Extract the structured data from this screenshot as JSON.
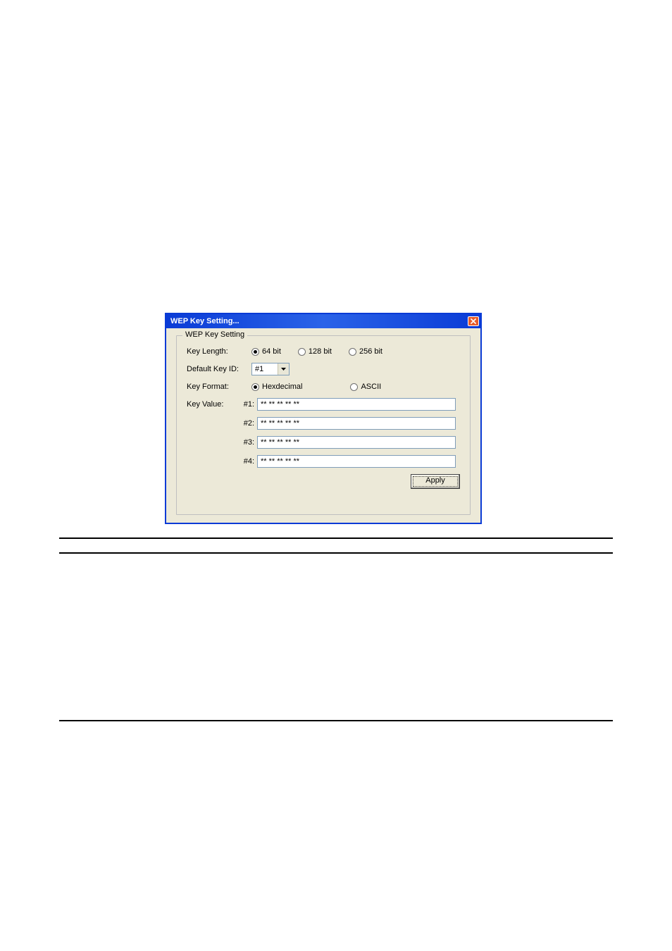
{
  "dialog": {
    "title": "WEP Key Setting...",
    "groupTitle": "WEP Key Setting",
    "labels": {
      "keyLength": "Key Length:",
      "defaultKeyId": "Default Key ID:",
      "keyFormat": "Key Format:",
      "keyValue": "Key Value:"
    },
    "keyLengthOptions": {
      "opt64": "64 bit",
      "opt128": "128 bit",
      "opt256": "256 bit"
    },
    "defaultKeyIdValue": "#1",
    "keyFormatOptions": {
      "hex": "Hexdecimal",
      "ascii": "ASCII"
    },
    "keyIdx": {
      "k1": "#1:",
      "k2": "#2:",
      "k3": "#3:",
      "k4": "#4:"
    },
    "keyValues": {
      "k1": "** ** ** ** **",
      "k2": "** ** ** ** **",
      "k3": "** ** ** ** **",
      "k4": "** ** ** ** **"
    },
    "applyLabel": "Apply"
  }
}
